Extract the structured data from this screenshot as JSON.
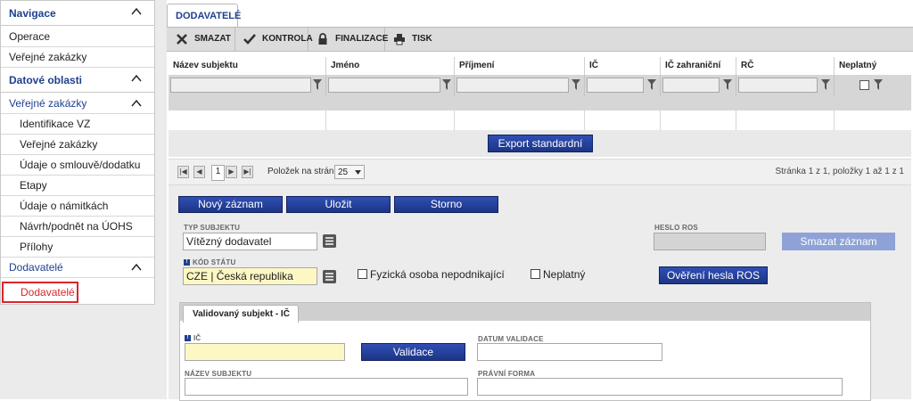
{
  "sidebar": {
    "sections": [
      {
        "label": "Navigace"
      },
      {
        "label": "Datové oblasti"
      },
      {
        "label": "Veřejné zakázky"
      },
      {
        "label": "Dodavatelé"
      }
    ],
    "nav_items": [
      "Operace",
      "Veřejné zakázky"
    ],
    "vz_items": [
      "Identifikace VZ",
      "Veřejné zakázky",
      "Údaje o smlouvě/dodatku",
      "Etapy",
      "Údaje o námitkách",
      "Návrh/podnět na ÚOHS",
      "Přílohy"
    ],
    "active_item": "Dodavatelé"
  },
  "tab": {
    "label": "DODAVATELÉ"
  },
  "toolbar": {
    "buttons": [
      {
        "label": "SMAZAT",
        "icon": "x-icon"
      },
      {
        "label": "KONTROLA",
        "icon": "check-icon"
      },
      {
        "label": "FINALIZACE",
        "icon": "lock-icon"
      },
      {
        "label": "TISK",
        "icon": "printer-icon"
      }
    ]
  },
  "grid": {
    "columns": [
      "Název subjektu",
      "Jméno",
      "Příjmení",
      "IČ",
      "IČ zahraniční",
      "RČ",
      "Neplatný"
    ]
  },
  "export_button": "Export standardní",
  "pager": {
    "current_page": "1",
    "per_page_label": "Položek na stránku",
    "per_page_value": "25",
    "summary": "Stránka 1 z 1, položky 1 až 1 z 1"
  },
  "form": {
    "buttons": {
      "new": "Nový záznam",
      "save": "Uložit",
      "cancel": "Storno",
      "delete": "Smazat záznam",
      "verify": "Ověření hesla ROS"
    },
    "typ_subjektu": {
      "label": "TYP SUBJEKTU",
      "value": "Vítězný dodavatel"
    },
    "heslo_ros": {
      "label": "HESLO ROS"
    },
    "kod_statu": {
      "label": "KÓD STÁTU",
      "value": "CZE | Česká republika"
    },
    "fyzicka_osoba": "Fyzická osoba nepodnikající",
    "neplatny": "Neplatný",
    "subtab": "Validovaný subjekt - IČ",
    "ic": {
      "label": "IČ"
    },
    "validace": "Validace",
    "datum_validace": {
      "label": "DATUM VALIDACE"
    },
    "nazev_subjektu": {
      "label": "NÁZEV SUBJEKTU"
    },
    "pravni_forma": {
      "label": "PRÁVNÍ FORMA"
    },
    "required_mark": "!"
  }
}
